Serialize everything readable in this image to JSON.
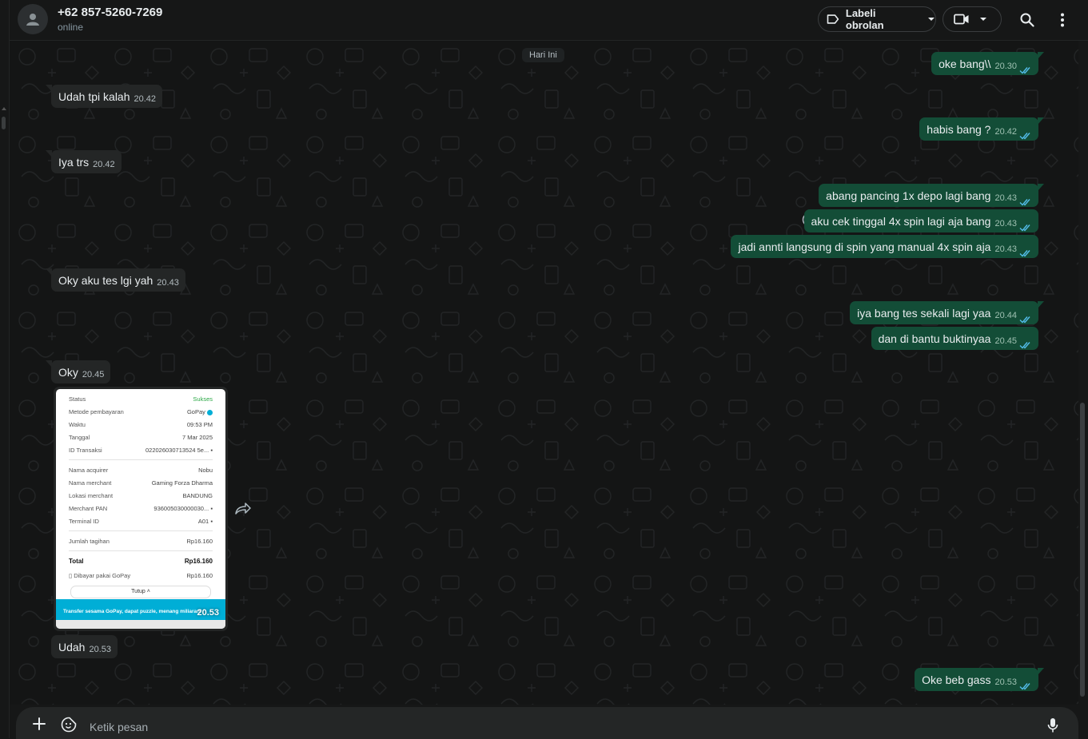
{
  "header": {
    "contact_name": "+62 857-5260-7269",
    "status": "online",
    "label_button": "Labeli obrolan",
    "icons": [
      "avatar-person-icon",
      "label-icon",
      "chevron-down-icon",
      "video-call-icon",
      "search-icon",
      "more-vert-icon"
    ]
  },
  "chat": {
    "day_chip": "Hari Ini",
    "messages": [
      {
        "dir": "out",
        "text": "oke bang\\\\",
        "time": "20.30"
      },
      {
        "dir": "in",
        "text": "Udah tpi kalah",
        "time": "20.42"
      },
      {
        "dir": "out",
        "text": "habis bang ?",
        "time": "20.42"
      },
      {
        "dir": "in",
        "text": "Iya trs",
        "time": "20.42"
      },
      {
        "dir": "out",
        "text": "abang pancing 1x depo lagi bang",
        "time": "20.43"
      },
      {
        "dir": "out",
        "text": "aku cek tinggal 4x spin lagi aja bang",
        "time": "20.43"
      },
      {
        "dir": "out",
        "text": "jadi annti langsung di spin yang manual 4x spin aja",
        "time": "20.43"
      },
      {
        "dir": "in",
        "text": "Oky aku tes lgi yah",
        "time": "20.43"
      },
      {
        "dir": "out",
        "text": "iya bang tes sekali lagi yaa",
        "time": "20.44"
      },
      {
        "dir": "out",
        "text": "dan di bantu buktinyaa",
        "time": "20.45"
      },
      {
        "dir": "in",
        "text": "Oky",
        "time": "20.45"
      },
      {
        "dir": "in",
        "text": "Udah",
        "time": "20.53"
      },
      {
        "dir": "out",
        "text": "Oke beb gass",
        "time": "20.53"
      }
    ],
    "image_message": {
      "time": "20.53",
      "receipt": [
        {
          "k": "Status",
          "v": "Sukses"
        },
        {
          "k": "Metode pembayaran",
          "v": "GoPay"
        },
        {
          "k": "Waktu",
          "v": "09:53 PM"
        },
        {
          "k": "Tanggal",
          "v": "7 Mar 2025"
        },
        {
          "k": "ID Transaksi",
          "v": "022026030713524 5e..."
        },
        {
          "k": "Nama acquirer",
          "v": "Nobu"
        },
        {
          "k": "Nama merchant",
          "v": "Gaming Forza Dharma"
        },
        {
          "k": "Lokasi merchant",
          "v": "BANDUNG"
        },
        {
          "k": "Merchant PAN",
          "v": "936005030000030..."
        },
        {
          "k": "Terminal ID",
          "v": "A01"
        },
        {
          "k": "Jumlah tagihan",
          "v": "Rp16.160"
        },
        {
          "k": "Total",
          "v": "Rp16.160"
        },
        {
          "k": "Dibayar pakai GoPay",
          "v": "Rp16.160"
        }
      ],
      "close_button": "Tutup",
      "banner": "Transfer sesama GoPay, dapat puzzle, menang miliaran!"
    }
  },
  "composer": {
    "placeholder": "Ketik pesan"
  },
  "colors": {
    "background": "#141515",
    "incoming_bubble": "#242626",
    "outgoing_bubble": "#134d37",
    "read_ticks": "#53bdeb",
    "sukses_green": "#2aa845",
    "gopay_banner": "#00aed6"
  }
}
